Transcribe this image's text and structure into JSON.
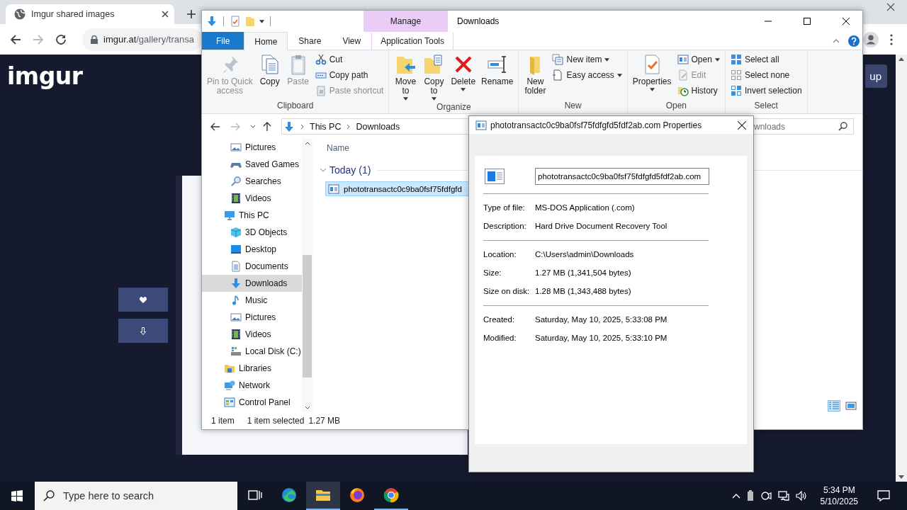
{
  "browser": {
    "tab": {
      "title": "Imgur shared images"
    },
    "address": {
      "host": "imgur.at",
      "path": "/gallery/transa"
    },
    "page": {
      "logo": "imgur",
      "signup_button": "up"
    }
  },
  "explorer": {
    "title": "Downloads",
    "context_group": "Manage",
    "tabs": [
      {
        "label": "File",
        "kind": "file",
        "selected": false
      },
      {
        "label": "Home",
        "kind": "tab",
        "selected": true
      },
      {
        "label": "Share",
        "kind": "tab",
        "selected": false
      },
      {
        "label": "View",
        "kind": "tab",
        "selected": false
      },
      {
        "label": "Application Tools",
        "kind": "context",
        "selected": false
      }
    ],
    "ribbon": [
      {
        "name": "Clipboard",
        "commands": [
          {
            "label": "Pin to Quick\naccess",
            "kind": "large",
            "disabled": true,
            "dropdown": false
          },
          {
            "label": "Copy",
            "kind": "large",
            "disabled": false,
            "dropdown": false
          },
          {
            "label": "Paste",
            "kind": "large",
            "disabled": true,
            "dropdown": false
          },
          {
            "label": "Cut",
            "kind": "small",
            "disabled": false,
            "dropdown": false
          },
          {
            "label": "Copy path",
            "kind": "small",
            "disabled": false,
            "dropdown": false
          },
          {
            "label": "Paste shortcut",
            "kind": "small",
            "disabled": true,
            "dropdown": false
          }
        ]
      },
      {
        "name": "Organize",
        "commands": [
          {
            "label": "Move\nto",
            "kind": "large",
            "disabled": false,
            "dropdown": true
          },
          {
            "label": "Copy\nto",
            "kind": "large",
            "disabled": false,
            "dropdown": true
          },
          {
            "label": "Delete",
            "kind": "large",
            "disabled": false,
            "dropdown": true
          },
          {
            "label": "Rename",
            "kind": "large",
            "disabled": false,
            "dropdown": false
          }
        ]
      },
      {
        "name": "New",
        "commands": [
          {
            "label": "New\nfolder",
            "kind": "large",
            "disabled": false,
            "dropdown": false
          },
          {
            "label": "New item",
            "kind": "small",
            "disabled": false,
            "dropdown": true
          },
          {
            "label": "Easy access",
            "kind": "small",
            "disabled": false,
            "dropdown": true
          }
        ]
      },
      {
        "name": "Open",
        "commands": [
          {
            "label": "Properties",
            "kind": "large",
            "disabled": false,
            "dropdown": true
          },
          {
            "label": "Open",
            "kind": "small",
            "disabled": false,
            "dropdown": true
          },
          {
            "label": "Edit",
            "kind": "small",
            "disabled": true,
            "dropdown": false
          },
          {
            "label": "History",
            "kind": "small",
            "disabled": false,
            "dropdown": false
          }
        ]
      },
      {
        "name": "Select",
        "commands": [
          {
            "label": "Select all",
            "kind": "small",
            "disabled": false,
            "dropdown": false
          },
          {
            "label": "Select none",
            "kind": "small",
            "disabled": false,
            "dropdown": false
          },
          {
            "label": "Invert selection",
            "kind": "small",
            "disabled": false,
            "dropdown": false
          }
        ]
      }
    ],
    "breadcrumb": [
      "This PC",
      "Downloads"
    ],
    "search": {
      "placeholder": "wnloads"
    },
    "nav": {
      "continued_children": [
        {
          "label": "Pictures",
          "selected": false
        },
        {
          "label": "Saved Games",
          "selected": false
        },
        {
          "label": "Searches",
          "selected": false
        },
        {
          "label": "Videos",
          "selected": false
        }
      ],
      "items": [
        {
          "label": "This PC",
          "selected": false,
          "children": [
            {
              "label": "3D Objects",
              "selected": false
            },
            {
              "label": "Desktop",
              "selected": false
            },
            {
              "label": "Documents",
              "selected": false
            },
            {
              "label": "Downloads",
              "selected": true
            },
            {
              "label": "Music",
              "selected": false
            },
            {
              "label": "Pictures",
              "selected": false
            },
            {
              "label": "Videos",
              "selected": false
            },
            {
              "label": "Local Disk (C:)",
              "selected": false
            }
          ]
        },
        {
          "label": "Libraries",
          "selected": false
        },
        {
          "label": "Network",
          "selected": false
        },
        {
          "label": "Control Panel",
          "selected": false
        }
      ]
    },
    "column_header": "Name",
    "groups": [
      {
        "label": "Today (1)",
        "expanded": true,
        "files": [
          {
            "name": "phototransactc0c9ba0fsf75fdfgfd",
            "selected": true
          }
        ]
      }
    ],
    "status": {
      "count": "1 item",
      "selection": "1 item selected",
      "size": "1.27 MB"
    }
  },
  "properties": {
    "title": "phototransactc0c9ba0fsf75fdfgfd5fdf2ab.com Properties",
    "file_name": "phototransactc0c9ba0fsf75fdfgfd5fdf2ab.com",
    "sections": [
      [
        {
          "label": "Type of file:",
          "value": "MS-DOS Application (.com)"
        },
        {
          "label": "Description:",
          "value": "Hard Drive Document Recovery Tool"
        }
      ],
      [
        {
          "label": "Location:",
          "value": "C:\\Users\\admin\\Downloads"
        },
        {
          "label": "Size:",
          "value": "1.27 MB (1,341,504 bytes)"
        },
        {
          "label": "Size on disk:",
          "value": "1.28 MB (1,343,488 bytes)"
        }
      ],
      [
        {
          "label": "Created:",
          "value": "Saturday, May 10, 2025, 5:33:08 PM"
        },
        {
          "label": "Modified:",
          "value": "Saturday, May 10, 2025, 5:33:10 PM"
        }
      ]
    ]
  },
  "taskbar": {
    "search_placeholder": "Type here to search",
    "apps": [
      {
        "selected": false,
        "running": false
      },
      {
        "selected": true,
        "running": true
      },
      {
        "selected": false,
        "running": false
      },
      {
        "selected": false,
        "running": true
      }
    ],
    "time": "5:34 PM",
    "date": "5/10/2025"
  }
}
